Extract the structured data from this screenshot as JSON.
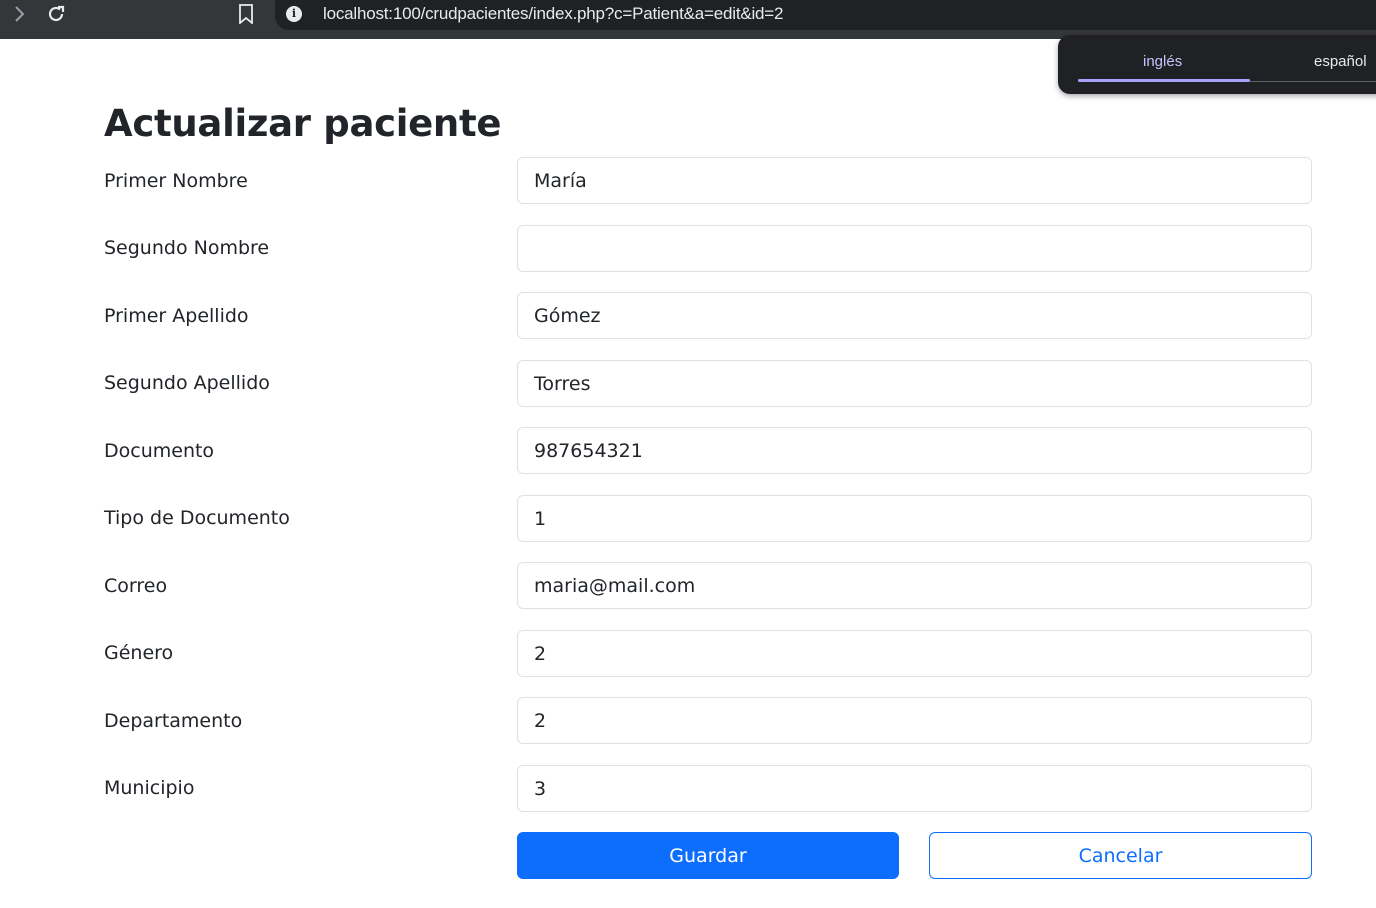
{
  "browser": {
    "url": "localhost:100/crudpacientes/index.php?c=Patient&a=edit&id=2",
    "icons": [
      "chevron-right-icon",
      "reload-icon",
      "bookmark-icon",
      "info-icon"
    ],
    "info_glyph": "i"
  },
  "translate": {
    "tabs": [
      "inglés",
      "español"
    ],
    "active_index": 0
  },
  "form": {
    "title": "Actualizar paciente",
    "fields": [
      {
        "label": "Primer Nombre",
        "value": "María"
      },
      {
        "label": "Segundo Nombre",
        "value": ""
      },
      {
        "label": "Primer Apellido",
        "value": "Gómez"
      },
      {
        "label": "Segundo Apellido",
        "value": "Torres"
      },
      {
        "label": "Documento",
        "value": "987654321"
      },
      {
        "label": "Tipo de Documento",
        "value": "1"
      },
      {
        "label": "Correo",
        "value": "maria@mail.com"
      },
      {
        "label": "Género",
        "value": "2"
      },
      {
        "label": "Departamento",
        "value": "2"
      },
      {
        "label": "Municipio",
        "value": "3"
      }
    ],
    "save_label": "Guardar",
    "cancel_label": "Cancelar"
  },
  "colors": {
    "primary": "#0d6efd",
    "browser_bar": "#35363a",
    "omnibox": "#202124",
    "active_tab": "#c8c2ff"
  }
}
